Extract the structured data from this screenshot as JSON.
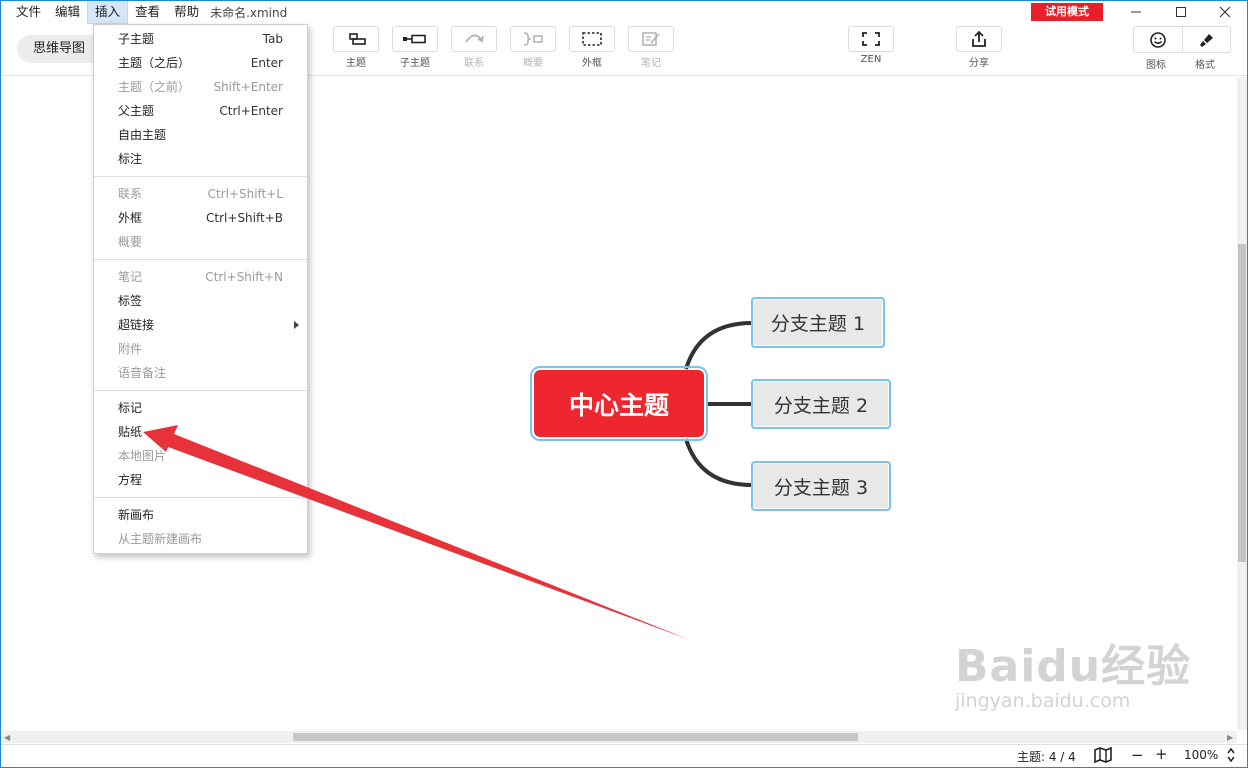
{
  "menubar": {
    "items": [
      {
        "label": "文件"
      },
      {
        "label": "编辑"
      },
      {
        "label": "插入",
        "active": true
      },
      {
        "label": "查看"
      },
      {
        "label": "帮助"
      }
    ],
    "doc_title": "未命名.xmind",
    "trial_badge": "试用模式",
    "window_controls": [
      "minimize-icon",
      "maximize-icon",
      "close-icon"
    ]
  },
  "toolbar": {
    "mindmap_tab": "思维导图",
    "tools": [
      {
        "label": "主题",
        "icon": "topic-icon",
        "enabled": true
      },
      {
        "label": "子主题",
        "icon": "subtopic-icon",
        "enabled": true
      },
      {
        "label": "联系",
        "icon": "relationship-icon",
        "enabled": false
      },
      {
        "label": "概要",
        "icon": "summary-icon",
        "enabled": false
      },
      {
        "label": "外框",
        "icon": "boundary-icon",
        "enabled": true
      },
      {
        "label": "笔记",
        "icon": "notes-icon",
        "enabled": false
      },
      {
        "label": "ZEN",
        "icon": "zen-mode-icon",
        "enabled": true
      },
      {
        "label": "分享",
        "icon": "share-icon",
        "enabled": true
      }
    ],
    "icon_panel_label": "图标",
    "format_panel_label": "格式"
  },
  "insert_menu": {
    "groups": [
      [
        {
          "label": "子主题",
          "shortcut": "Tab",
          "enabled": true
        },
        {
          "label": "主题（之后）",
          "shortcut": "Enter",
          "enabled": true
        },
        {
          "label": "主题（之前）",
          "shortcut": "Shift+Enter",
          "enabled": false
        },
        {
          "label": "父主题",
          "shortcut": "Ctrl+Enter",
          "enabled": true
        },
        {
          "label": "自由主题",
          "shortcut": "",
          "enabled": true
        },
        {
          "label": "标注",
          "shortcut": "",
          "enabled": true
        }
      ],
      [
        {
          "label": "联系",
          "shortcut": "Ctrl+Shift+L",
          "enabled": false
        },
        {
          "label": "外框",
          "shortcut": "Ctrl+Shift+B",
          "enabled": true
        },
        {
          "label": "概要",
          "shortcut": "",
          "enabled": false
        }
      ],
      [
        {
          "label": "笔记",
          "shortcut": "Ctrl+Shift+N",
          "enabled": false
        },
        {
          "label": "标签",
          "shortcut": "",
          "enabled": true
        },
        {
          "label": "超链接",
          "shortcut": "",
          "enabled": true,
          "submenu": true
        },
        {
          "label": "附件",
          "shortcut": "",
          "enabled": false
        },
        {
          "label": "语音备注",
          "shortcut": "",
          "enabled": false
        }
      ],
      [
        {
          "label": "标记",
          "shortcut": "",
          "enabled": true
        },
        {
          "label": "贴纸",
          "shortcut": "",
          "enabled": true,
          "highlighted_by_arrow": true
        },
        {
          "label": "本地图片",
          "shortcut": "",
          "enabled": false
        },
        {
          "label": "方程",
          "shortcut": "",
          "enabled": true
        }
      ],
      [
        {
          "label": "新画布",
          "shortcut": "",
          "enabled": true
        },
        {
          "label": "从主题新建画布",
          "shortcut": "",
          "enabled": false
        }
      ]
    ]
  },
  "mindmap": {
    "central_topic": "中心主题",
    "branches": [
      "分支主题 1",
      "分支主题 2",
      "分支主题 3"
    ],
    "colors": {
      "central": "#ed2630",
      "branch_fill": "#e8e8e8",
      "selection": "#7cc3ec",
      "connector": "#333333"
    }
  },
  "annotation": {
    "arrow_color": "#e8323a",
    "points_to": "贴纸"
  },
  "statusbar": {
    "topic_count": "主题: 4 / 4",
    "zoom": "100%"
  },
  "watermark": {
    "logo": "Baidu经验",
    "sub": "jingyan.baidu.com"
  }
}
